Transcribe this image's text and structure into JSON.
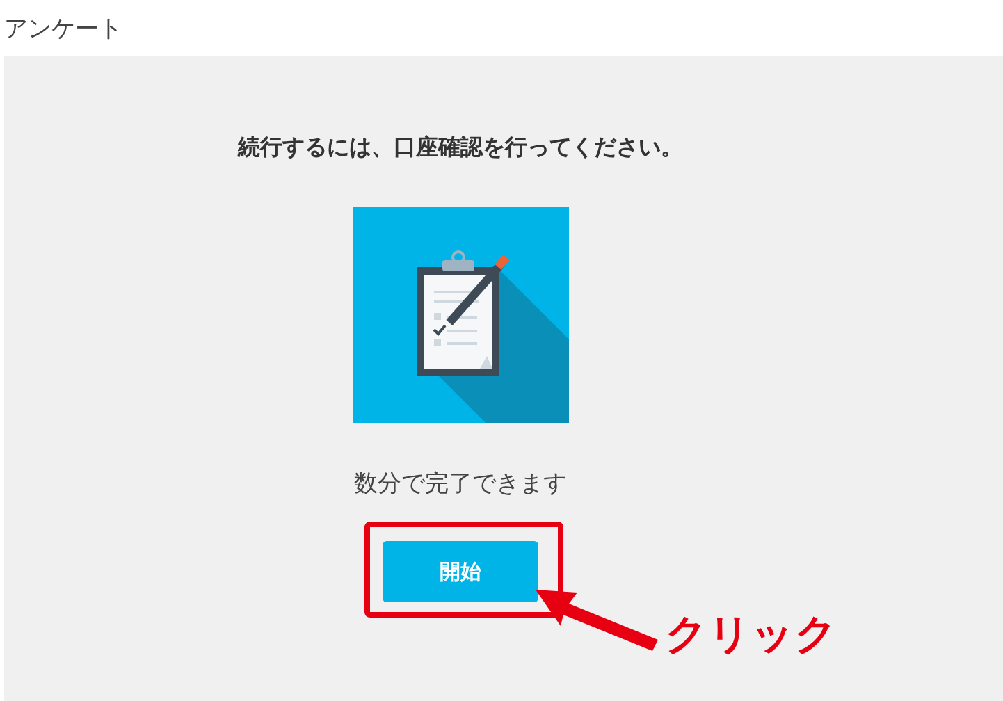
{
  "page_title": "アンケート",
  "panel": {
    "heading": "続行するには、口座確認を行ってください。",
    "note": "数分で完了できます",
    "button": "開始"
  },
  "annotation": {
    "label": "クリック"
  }
}
